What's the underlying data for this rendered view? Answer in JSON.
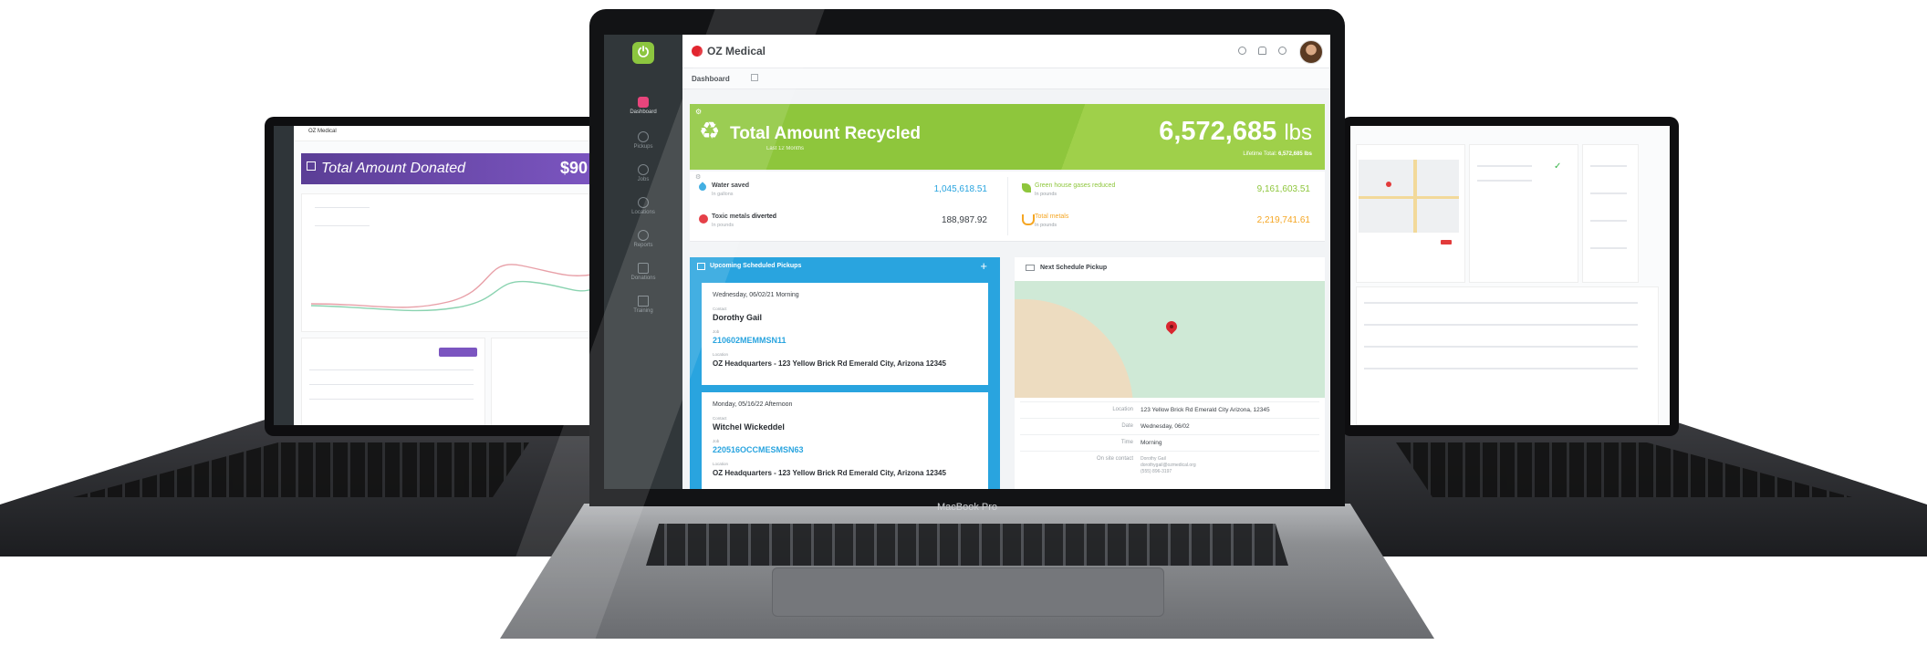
{
  "main": {
    "brand": "OZ Medical",
    "device_label": "MacBook Pro",
    "nav": [
      {
        "label": "Dashboard"
      },
      {
        "label": "Pickups"
      },
      {
        "label": "Jobs"
      },
      {
        "label": "Locations"
      },
      {
        "label": "Reports"
      },
      {
        "label": "Donations"
      },
      {
        "label": "Training"
      }
    ],
    "breadcrumb": "Dashboard",
    "hero": {
      "title": "Total Amount Recycled",
      "subtitle": "Last 12 Months",
      "value": "6,572,685",
      "unit": "lbs",
      "lifetime_label": "Lifetime Total:",
      "lifetime_value": "6,572,685 lbs"
    },
    "metrics": [
      {
        "label": "Water saved",
        "sub": "In gallons",
        "value": "1,045,618.51",
        "color": "#29a4df"
      },
      {
        "label": "Green house gases reduced",
        "sub": "In pounds",
        "value": "9,161,603.51",
        "color": "#8ec63c"
      },
      {
        "label": "Toxic metals diverted",
        "sub": "In pounds",
        "value": "188,987.92",
        "color": "#e2262f"
      },
      {
        "label": "Total metals",
        "sub": "In pounds",
        "value": "2,219,741.61",
        "color": "#f5a623"
      }
    ],
    "pickups": {
      "title": "Upcoming Scheduled Pickups",
      "items": [
        {
          "date": "Wednesday, 06/02/21 Morning",
          "contact_label": "Contact",
          "contact": "Dorothy Gail",
          "job_label": "Job",
          "job": "210602MEMMSN11",
          "location_label": "Location",
          "location": "OZ Headquarters - 123 Yellow Brick Rd Emerald City, Arizona 12345"
        },
        {
          "date": "Monday, 05/16/22 Afternoon",
          "contact_label": "Contact",
          "contact": "Witchel Wickeddel",
          "job_label": "Job",
          "job": "220516OCCMESMSN63",
          "location_label": "Location",
          "location": "OZ Headquarters - 123 Yellow Brick Rd Emerald City, Arizona 12345"
        }
      ]
    },
    "next_pickup": {
      "title": "Next Schedule Pickup",
      "rows": [
        {
          "label": "Location",
          "value": "123 Yellow Brick Rd Emerald City Arizona, 12345"
        },
        {
          "label": "Date",
          "value": "Wednesday, 06/02"
        },
        {
          "label": "Time",
          "value": "Morning"
        },
        {
          "label": "On site contact",
          "value": "Dorothy Gail",
          "sub1": "dorothygail@ozmedical.org",
          "sub2": "(555) 896-3197"
        }
      ]
    },
    "colors": {
      "accent_green": "#8ec63c",
      "accent_blue": "#29a4df",
      "brand_red": "#e2262f"
    }
  },
  "left_laptop": {
    "brand": "OZ Medical",
    "hero_title": "Total Amount Donated",
    "hero_value": "$90",
    "color": "#6b4aad"
  }
}
